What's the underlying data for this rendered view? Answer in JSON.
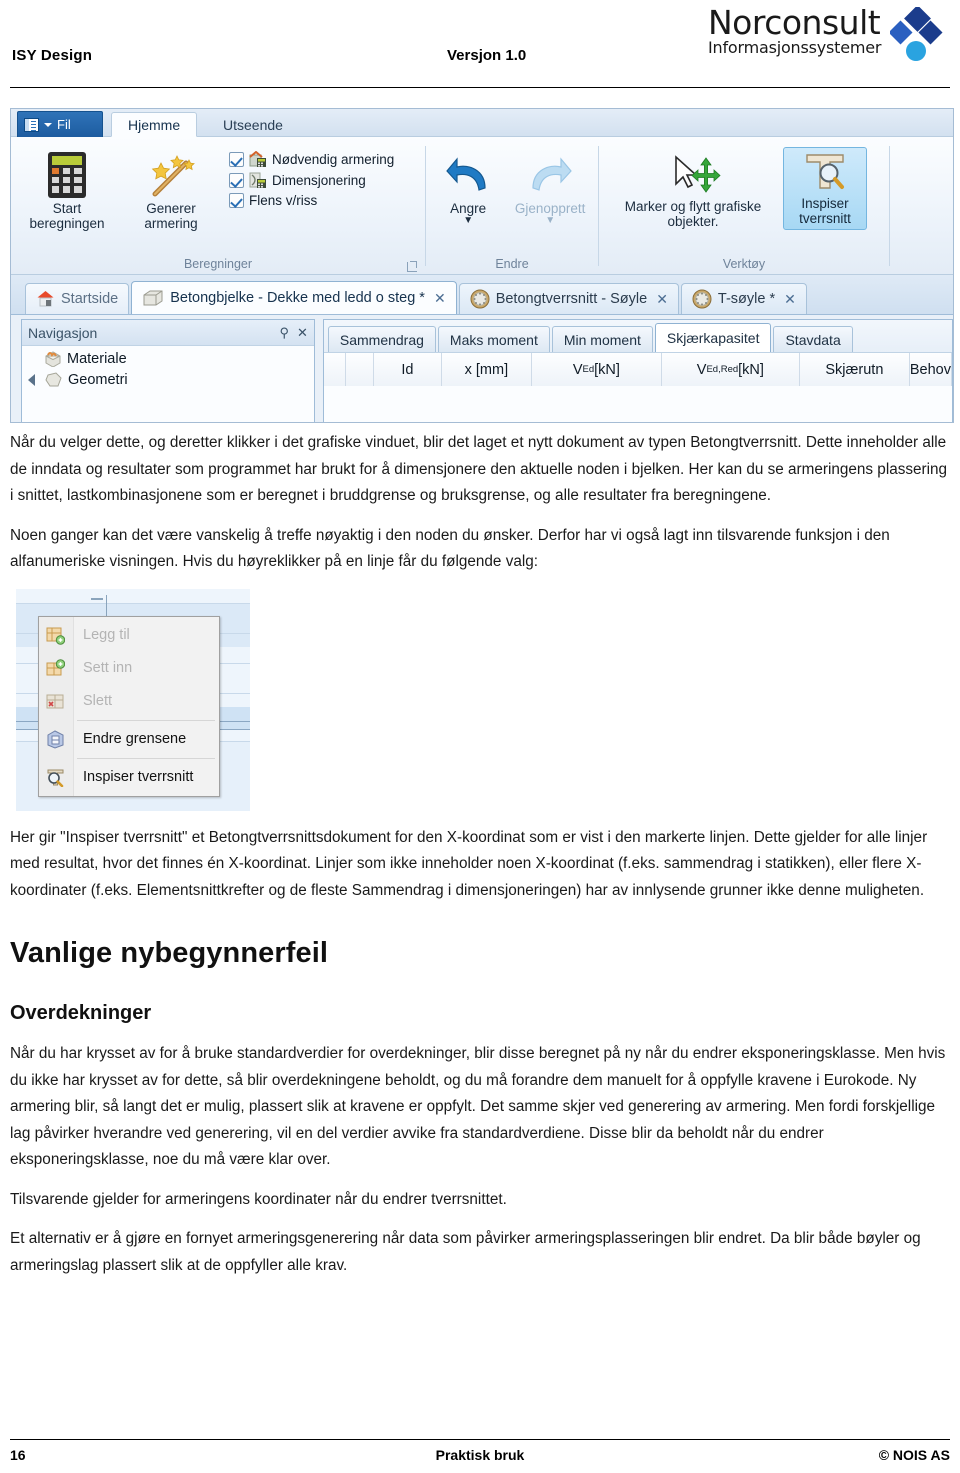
{
  "header": {
    "left_title": "ISY Design",
    "version": "Versjon 1.0",
    "logo_name": "Norconsult",
    "logo_sub": "Informasjonssystemer",
    "logo_dark_blue": "#1b3c8c",
    "logo_mid_blue": "#2a5fc0",
    "logo_light_blue": "#2aa3e0"
  },
  "app_screenshot": {
    "file_button": "Fil",
    "ribbon_tabs": [
      {
        "label": "Hjemme",
        "active": true
      },
      {
        "label": "Utseende",
        "active": false
      }
    ],
    "groups": {
      "beregninger": {
        "title": "Beregninger",
        "start_button_line1": "Start",
        "start_button_line2": "beregningen",
        "generate_button_line1": "Generer",
        "generate_button_line2": "armering",
        "checkboxes": [
          {
            "label": "Nødvendig armering",
            "checked": true,
            "has_icon": true
          },
          {
            "label": "Dimensjonering",
            "checked": true,
            "has_icon": true
          },
          {
            "label": "Flens v/riss",
            "checked": true,
            "has_icon": false
          }
        ]
      },
      "endre": {
        "title": "Endre",
        "undo_label": "Angre",
        "redo_label": "Gjenopprett"
      },
      "verktoy": {
        "title": "Verktøy",
        "move_tool_line1": "Marker og flytt grafiske",
        "move_tool_line2": "objekter.",
        "inspect_line1": "Inspiser",
        "inspect_line2": "tverrsnitt",
        "inspect_selected": true
      }
    },
    "document_tabs": [
      {
        "label": "Startside",
        "icon": "house-icon",
        "closable": false,
        "selected": false
      },
      {
        "label": "Betongbjelke - Dekke med ledd o steg *",
        "icon": "beam-icon",
        "closable": true,
        "selected": true
      },
      {
        "label": "Betongtverrsnitt - Søyle",
        "icon": "column-section-icon",
        "closable": true,
        "selected": false
      },
      {
        "label": "T-søyle *",
        "icon": "column-section-icon",
        "closable": true,
        "selected": false
      }
    ],
    "navigation_panel": {
      "title": "Navigasjon",
      "pin_icon": "pin-icon",
      "close_icon": "close-icon",
      "items": [
        {
          "label": "Materiale",
          "expandable": false
        },
        {
          "label": "Geometri",
          "expandable": true
        }
      ]
    },
    "result_grid": {
      "tabs": [
        {
          "label": "Sammendrag",
          "selected": false
        },
        {
          "label": "Maks moment",
          "selected": false
        },
        {
          "label": "Min moment",
          "selected": false
        },
        {
          "label": "Skjærkapasitet",
          "selected": true
        },
        {
          "label": "Stavdata",
          "selected": false
        }
      ],
      "columns": [
        {
          "label": "",
          "sub": ""
        },
        {
          "label": "Id",
          "sub": ""
        },
        {
          "label": "x [mm]",
          "sub": ""
        },
        {
          "label": "V",
          "sub": "Ed",
          "unit": " [kN]"
        },
        {
          "label": "V",
          "sub": "Ed,Red",
          "unit": " [kN]"
        },
        {
          "label": "Skjærutn",
          "sub": ""
        },
        {
          "label": "Behov",
          "sub": ""
        }
      ]
    }
  },
  "body": {
    "paragraph_1": "Når du velger dette, og deretter klikker i det grafiske vinduet, blir det laget et nytt dokument av typen Betongtverrsnitt. Dette inneholder alle de inndata og resultater som programmet har brukt for å dimensjonere den aktuelle noden i bjelken. Her kan du se armeringens plassering i snittet, lastkombinasjonene som er beregnet i bruddgrense og bruksgrense, og alle resultater fra beregningene.",
    "paragraph_2": "Noen ganger kan det være vanskelig å treffe nøyaktig i den noden du ønsker. Derfor har vi også lagt inn tilsvarende funksjon i den alfanumeriske visningen. Hvis du høyreklikker på en linje får du følgende valg:",
    "paragraph_3": "Her gir \"Inspiser tverrsnitt\" et Betongtverrsnittsdokument for den X-koordinat som er vist i den markerte linjen. Dette gjelder for alle linjer med resultat, hvor det finnes én X-koordinat. Linjer som ikke inneholder noen X-koordinat (f.eks. sammendrag i statikken), eller flere X-koordinater (f.eks. Elementsnittkrefter og de fleste Sammendrag i dimensjoneringen) har av innlysende grunner ikke denne muligheten.",
    "heading_1": "Vanlige nybegynnerfeil",
    "heading_2": "Overdekninger",
    "paragraph_4": "Når du har krysset av for å bruke standardverdier for overdekninger, blir disse beregnet på ny når du endrer eksponeringsklasse. Men hvis du ikke har krysset av for dette, så blir overdekningene beholdt, og du må forandre dem manuelt for å oppfylle kravene i Eurokode. Ny armering blir, så langt det er mulig, plassert slik at kravene er oppfylt. Det samme skjer ved generering av armering. Men fordi forskjellige lag påvirker hverandre ved generering, vil en del verdier avvike fra standardverdiene. Disse blir da beholdt når du endrer eksponeringsklasse, noe du må være klar over.",
    "paragraph_5": "Tilsvarende gjelder for armeringens koordinater når du endrer tverrsnittet.",
    "paragraph_6": "Et alternativ er å gjøre en fornyet armeringsgenerering når data som påvirker armeringsplasseringen blir endret. Da blir både bøyler og armeringslag plassert slik at de oppfyller alle krav."
  },
  "context_menu_screenshot": {
    "items": [
      {
        "label": "Legg til",
        "disabled": true,
        "icon": "add-row-icon",
        "separator_after": false
      },
      {
        "label": "Sett inn",
        "disabled": true,
        "icon": "insert-row-icon",
        "separator_after": false
      },
      {
        "label": "Slett",
        "disabled": true,
        "icon": "delete-row-icon",
        "separator_after": true
      },
      {
        "label": "Endre grensene",
        "disabled": false,
        "icon": "limits-icon",
        "separator_after": true
      },
      {
        "label": "Inspiser tverrsnitt",
        "disabled": false,
        "icon": "inspect-section-icon",
        "separator_after": false
      }
    ]
  },
  "footer": {
    "page_number": "16",
    "center": "Praktisk bruk",
    "right": "© NOIS AS"
  }
}
